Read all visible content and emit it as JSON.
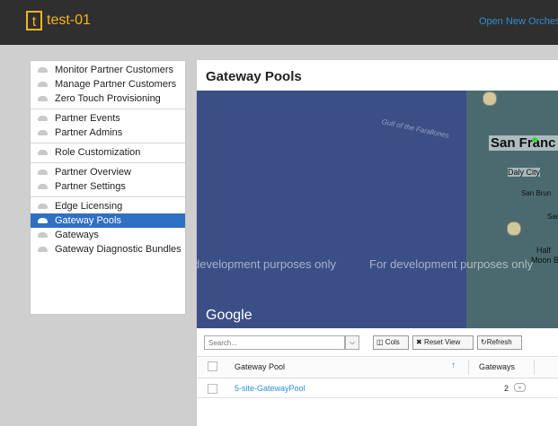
{
  "header": {
    "logo_letter": "t",
    "title": "test-01",
    "open_orchestrator": "Open New Orches"
  },
  "sidebar": {
    "groups": [
      [
        "Monitor Partner Customers",
        "Manage Partner Customers",
        "Zero Touch Provisioning"
      ],
      [
        "Partner Events",
        "Partner Admins"
      ],
      [
        "Role Customization"
      ],
      [
        "Partner Overview",
        "Partner Settings"
      ],
      [
        "Edge Licensing",
        "Gateway Pools",
        "Gateways",
        "Gateway Diagnostic Bundles"
      ]
    ],
    "active": "Gateway Pools"
  },
  "main": {
    "title": "Gateway Pools",
    "map": {
      "labels": {
        "gulf": "Gulf of the Farallones",
        "sf": "San Franc",
        "daly": "Daly City",
        "sanb": "San Brun",
        "san": "San",
        "half": "Half",
        "moon": "Moon Bay"
      },
      "watermark_left": "development purposes only",
      "watermark_right": "For development purposes only",
      "provider": "Google"
    },
    "toolbar": {
      "search_placeholder": "Search...",
      "cols": "Cols",
      "reset_view": "Reset View",
      "refresh": "Refresh"
    },
    "grid": {
      "columns": [
        "Gateway Pool",
        "Gateways"
      ],
      "rows": [
        {
          "gateway_pool": "5-site-GatewayPool",
          "gateways": "2"
        }
      ]
    }
  },
  "colors": {
    "accent": "#f5b51b",
    "link": "#2b8fd1",
    "active_nav": "#2f6fc4",
    "map_water": "#3b4f86"
  }
}
